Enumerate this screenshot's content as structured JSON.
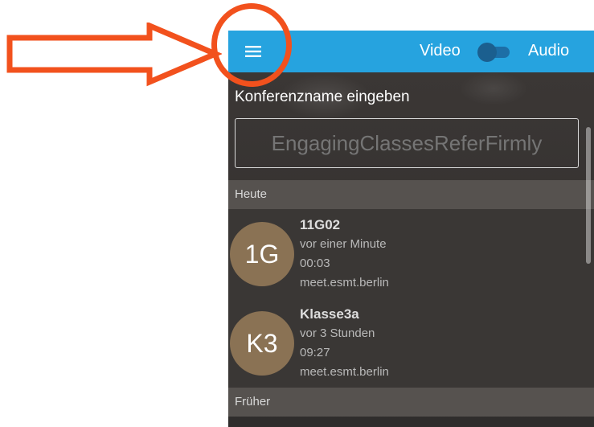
{
  "appbar": {
    "menu_icon": "menu-icon",
    "video_label": "Video",
    "audio_label": "Audio",
    "toggle_state": "video",
    "background_color": "#26a3df"
  },
  "conference": {
    "label": "Konferenzname eingeben",
    "placeholder": "EngagingClassesReferFirmly"
  },
  "sections": {
    "today": "Heute",
    "earlier": "Früher"
  },
  "recent": [
    {
      "initials": "1G",
      "name": "11G02",
      "time_ago": "vor einer Minute",
      "duration": "00:03",
      "server": "meet.esmt.berlin"
    },
    {
      "initials": "K3",
      "name": "Klasse3a",
      "time_ago": "vor 3 Stunden",
      "duration": "09:27",
      "server": "meet.esmt.berlin"
    }
  ],
  "annotation": {
    "arrow_icon": "arrow-right-icon",
    "circle_icon": "highlight-circle-icon",
    "color": "#f2511d"
  }
}
